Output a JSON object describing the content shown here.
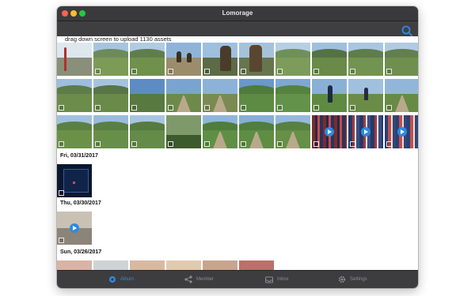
{
  "window": {
    "title": "Lomorage"
  },
  "banner": {
    "text": "drag down screen to upload 1130 assets"
  },
  "sections": [
    {
      "date": ""
    },
    {
      "date": "Fri, 03/31/2017"
    },
    {
      "date": "Thu, 03/30/2017"
    },
    {
      "date": "Sun, 03/26/2017"
    }
  ],
  "tabs": [
    {
      "label": "Album",
      "icon": "album-icon",
      "active": true
    },
    {
      "label": "Member",
      "icon": "member-icon",
      "active": false
    },
    {
      "label": "Inbox",
      "icon": "inbox-icon",
      "active": false
    },
    {
      "label": "Settings",
      "icon": "gear-icon",
      "active": false
    }
  ],
  "colors": {
    "accent": "#2d8ae0",
    "banner_line": "#3b6aa8",
    "titlebar": "#3a3a3c",
    "tabbar": "#3d3d40"
  }
}
